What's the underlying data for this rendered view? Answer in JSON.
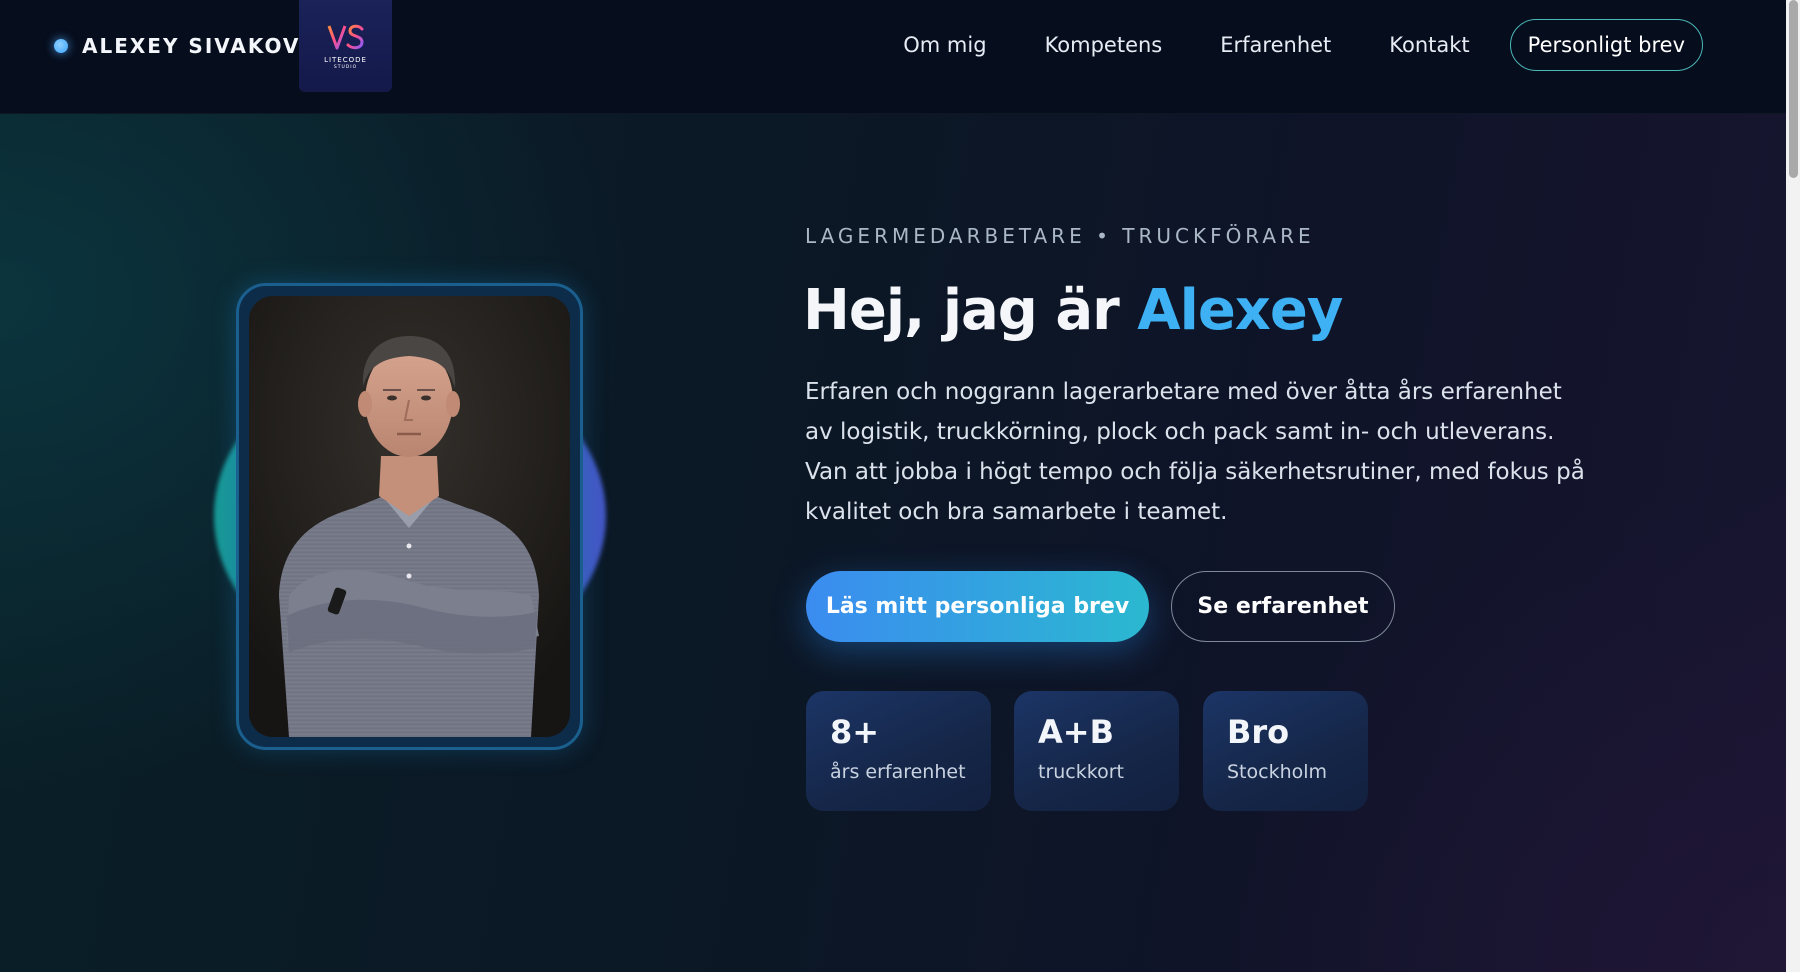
{
  "header": {
    "brand_name": "ALEXEY SIVAKOV",
    "logo": {
      "name": "LITECODE",
      "sub": "STUDIO"
    },
    "nav": [
      {
        "label": "Om mig"
      },
      {
        "label": "Kompetens"
      },
      {
        "label": "Erfarenhet"
      },
      {
        "label": "Kontakt"
      }
    ],
    "cta_label": "Personligt brev"
  },
  "hero": {
    "eyebrow": "LAGERMEDARBETARE • TRUCKFÖRARE",
    "headline_prefix": "Hej, jag är ",
    "headline_name": "Alexey",
    "intro": "Erfaren och noggrann lagerarbetare med över åtta års erfarenhet av logistik, truckkörning, plock och pack samt in- och utleverans. Van att jobba i högt tempo och följa säkerhetsrutiner, med fokus på kvalitet och bra samarbete i teamet.",
    "primary_button": "Läs mitt personliga brev",
    "secondary_button": "Se erfarenhet",
    "stats": [
      {
        "value": "8+",
        "label": "års erfarenhet"
      },
      {
        "value": "A+B",
        "label": "truckkort"
      },
      {
        "value": "Bro",
        "label": "Stockholm"
      }
    ]
  },
  "colors": {
    "accent": "#3db1f3",
    "primary_gradient_start": "#3b8cf0",
    "primary_gradient_end": "#2bb8d0",
    "nav_cta_border": "#4bb7b8"
  }
}
